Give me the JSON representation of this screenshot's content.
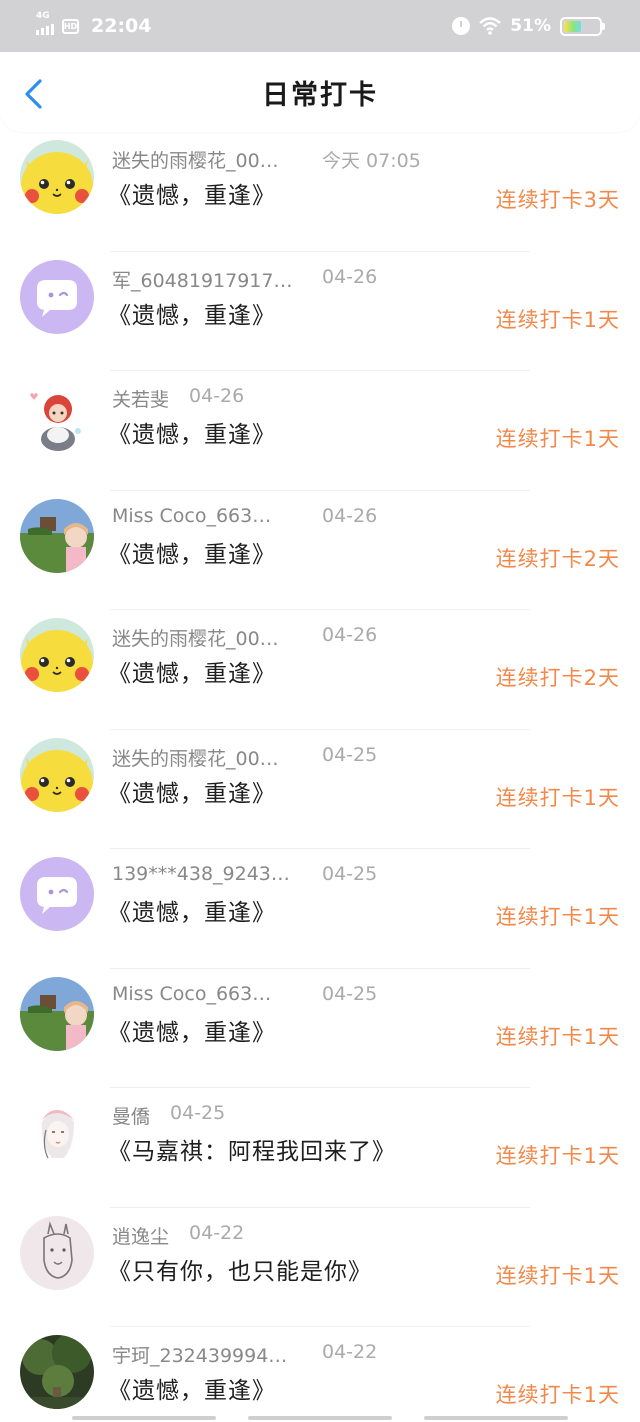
{
  "status_bar": {
    "network": "4G",
    "hd": "HD",
    "time": "22:04",
    "battery_text": "51%",
    "battery_level": 0.51,
    "icons": [
      "signal-icon",
      "hd-icon",
      "alarm-icon",
      "wifi-icon",
      "battery-icon"
    ]
  },
  "header": {
    "title": "日常打卡",
    "back_icon": "chevron-left-icon"
  },
  "colors": {
    "accent": "#f2884a",
    "back_arrow": "#2b8ef0",
    "status_bar_bg": "#d2d2d4"
  },
  "checkins": [
    {
      "name": "迷失的雨樱花_00…",
      "date": "今天  07:05",
      "title": "《遗憾，重逢》",
      "streak": "连续打卡3天",
      "avatar": "pikachu-avatar"
    },
    {
      "name": "军_60481917917…",
      "date": "04-26",
      "title": "《遗憾，重逢》",
      "streak": "连续打卡1天",
      "avatar": "chat-bubble-avatar"
    },
    {
      "name": "关若斐",
      "date": "04-26",
      "title": "《遗憾，重逢》",
      "streak": "连续打卡1天",
      "avatar": "doll-avatar"
    },
    {
      "name": "Miss  Coco_663…",
      "date": "04-26",
      "title": "《遗憾，重逢》",
      "streak": "连续打卡2天",
      "avatar": "photo-girl-avatar"
    },
    {
      "name": "迷失的雨樱花_00…",
      "date": "04-26",
      "title": "《遗憾，重逢》",
      "streak": "连续打卡2天",
      "avatar": "pikachu-avatar"
    },
    {
      "name": "迷失的雨樱花_00…",
      "date": "04-25",
      "title": "《遗憾，重逢》",
      "streak": "连续打卡1天",
      "avatar": "pikachu-avatar"
    },
    {
      "name": "139***438_9243…",
      "date": "04-25",
      "title": "《遗憾，重逢》",
      "streak": "连续打卡1天",
      "avatar": "chat-bubble-avatar"
    },
    {
      "name": "Miss  Coco_663…",
      "date": "04-25",
      "title": "《遗憾，重逢》",
      "streak": "连续打卡1天",
      "avatar": "photo-girl-avatar"
    },
    {
      "name": "曼僑",
      "date": "04-25",
      "title": "《马嘉祺：阿程我回来了》",
      "streak": "连续打卡1天",
      "avatar": "sketch-girl-avatar"
    },
    {
      "name": "逍逸尘",
      "date": "04-22",
      "title": "《只有你，也只能是你》",
      "streak": "连续打卡1天",
      "avatar": "llama-sketch-avatar"
    },
    {
      "name": "宇珂_232439994…",
      "date": "04-22",
      "title": "《遗憾，重逢》",
      "streak": "连续打卡1天",
      "avatar": "tree-photo-avatar"
    }
  ]
}
